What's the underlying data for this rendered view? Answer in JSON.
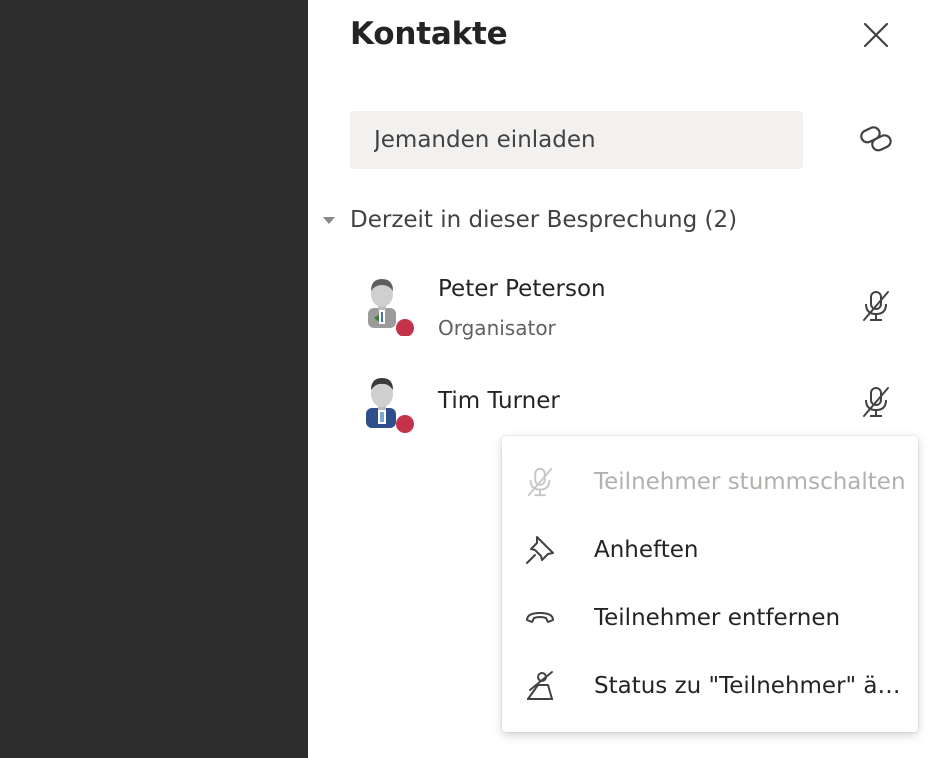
{
  "panel": {
    "title": "Kontakte",
    "invite_placeholder": "Jemanden einladen"
  },
  "section": {
    "label": "Derzeit in dieser Besprechung (2)"
  },
  "participants": [
    {
      "name": "Peter Peterson",
      "role": "Organisator",
      "status_color": "#c4314b",
      "icon": "mic-off-icon"
    },
    {
      "name": "Tim Turner",
      "role": "",
      "status_color": "#c4314b",
      "icon": "mic-off-icon"
    }
  ],
  "context_menu": {
    "items": [
      {
        "label": "Teilnehmer stummschalten",
        "icon": "mic-off-icon",
        "disabled": true
      },
      {
        "label": "Anheften",
        "icon": "pin-icon",
        "disabled": false
      },
      {
        "label": "Teilnehmer entfernen",
        "icon": "hang-up-icon",
        "disabled": false
      },
      {
        "label": "Status zu \"Teilnehmer\" ändern",
        "icon": "change-role-icon",
        "disabled": false
      }
    ]
  },
  "colors": {
    "left_area": "#2d2d2d",
    "invite_bg": "#f2f1f0",
    "text_primary": "#252423",
    "text_disabled": "#b3b0ad",
    "status_busy": "#c4314b"
  }
}
